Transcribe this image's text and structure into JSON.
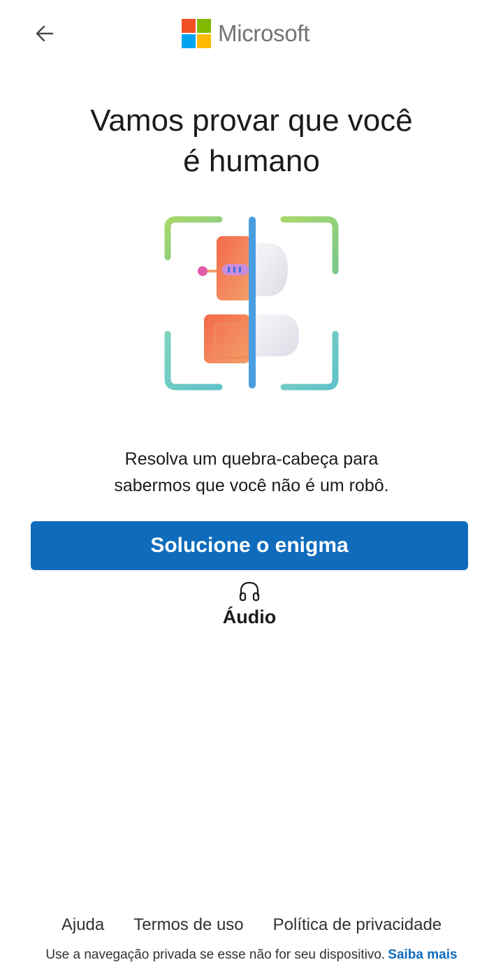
{
  "header": {
    "back_icon": "arrow-left-icon",
    "logo_text": "Microsoft",
    "logo_colors": [
      "#f25022",
      "#7fba00",
      "#00a4ef",
      "#ffb900"
    ]
  },
  "main": {
    "title_line1": "Vamos provar que você",
    "title_line2": "é humano",
    "description_line1": "Resolva um quebra-cabeça para",
    "description_line2": "sabermos que você não é um robô.",
    "solve_button": "Solucione o enigma",
    "audio_icon": "headphones-icon",
    "audio_label": "Áudio"
  },
  "footer": {
    "links": [
      "Ajuda",
      "Termos de uso",
      "Política de privacidade"
    ],
    "note": "Use a navegação privada se esse não for seu dispositivo.",
    "learn_more": "Saiba mais"
  },
  "colors": {
    "accent": "#0f6cbd",
    "text": "#1b1b1b"
  }
}
